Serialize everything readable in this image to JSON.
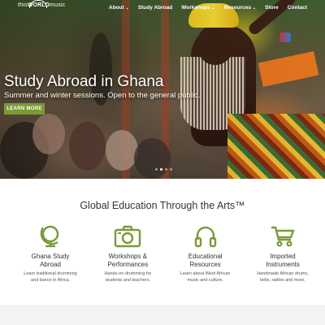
{
  "brand": {
    "logo_prefix": "this",
    "logo_world": "WORLD",
    "logo_suffix": "music"
  },
  "nav": {
    "items": [
      {
        "label": "About",
        "has_dropdown": true
      },
      {
        "label": "Study Abroad",
        "has_dropdown": false
      },
      {
        "label": "Workshops",
        "has_dropdown": true
      },
      {
        "label": "Resources",
        "has_dropdown": true
      },
      {
        "label": "Store",
        "has_dropdown": false
      },
      {
        "label": "Contact",
        "has_dropdown": false
      }
    ],
    "chevron": "⌄"
  },
  "hero": {
    "title": "Study Abroad in Ghana",
    "subtitle": "Summer and winter sessions. Open to the general public.",
    "button_label": "LEARN MORE",
    "slides": 4,
    "active_slide": 2
  },
  "section": {
    "title": "Global Education Through the Arts™",
    "features": [
      {
        "icon": "globe-icon",
        "title_line1": "Ghana Study",
        "title_line2": "Abroad",
        "desc_line1": "Learn traditional drumming",
        "desc_line2": "and dance in Africa."
      },
      {
        "icon": "camera-icon",
        "title_line1": "Workshops &",
        "title_line2": "Performances",
        "desc_line1": "Hands-on drumming for",
        "desc_line2": "students and teachers."
      },
      {
        "icon": "headphones-icon",
        "title_line1": "Educational",
        "title_line2": "Resources",
        "desc_line1": "Learn about West African",
        "desc_line2": "music and culture."
      },
      {
        "icon": "cart-icon",
        "title_line1": "Imported",
        "title_line2": "Instruments",
        "desc_line1": "Handmade African drums,",
        "desc_line2": "bells, rattles and more."
      }
    ]
  },
  "colors": {
    "accent": "#7a9a38",
    "text": "#333333"
  }
}
